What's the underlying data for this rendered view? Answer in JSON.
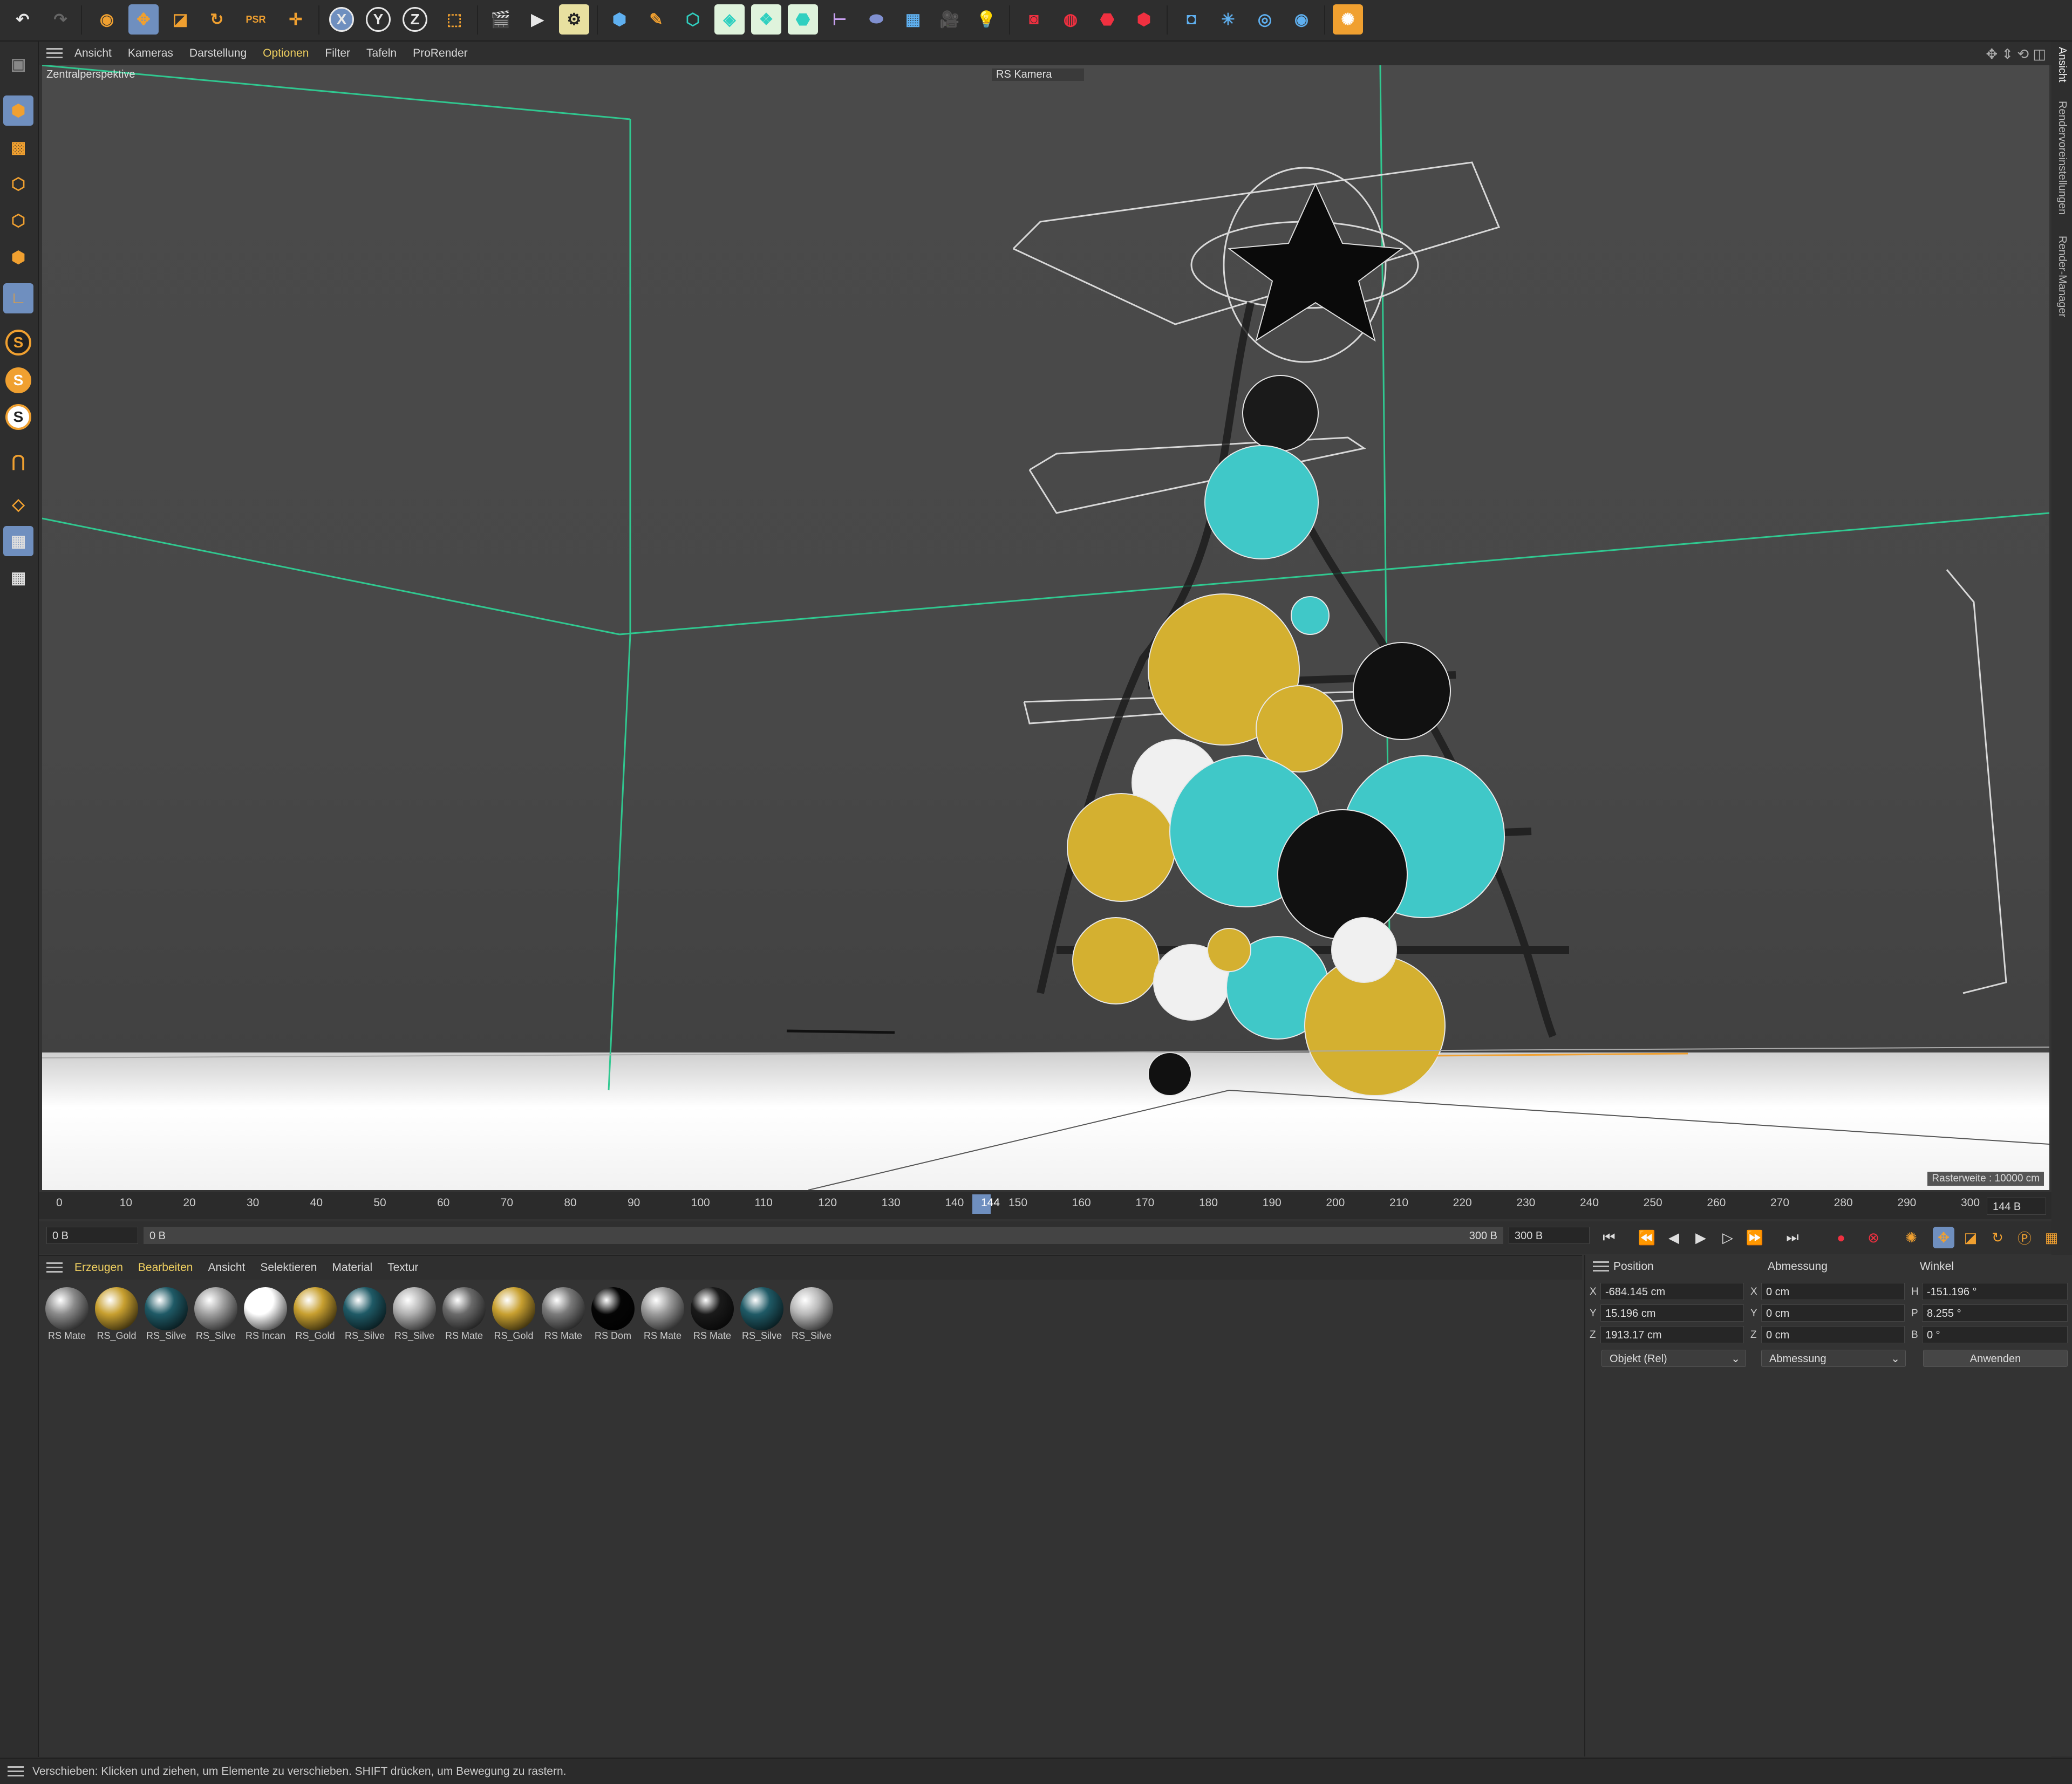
{
  "viewport": {
    "menu": [
      "Ansicht",
      "Kameras",
      "Darstellung",
      "Optionen",
      "Filter",
      "Tafeln",
      "ProRender"
    ],
    "active_menu": "Optionen",
    "perspective_label": "Zentralperspektive",
    "camera_label": "RS Kamera",
    "raster_label": "Rasterweite : 10000 cm"
  },
  "right_tabs": [
    "Ansicht",
    "Rendervoreinstellungen",
    "Render-Manager"
  ],
  "timeline": {
    "ticks": [
      "0",
      "10",
      "20",
      "30",
      "40",
      "50",
      "60",
      "70",
      "80",
      "90",
      "100",
      "110",
      "120",
      "130",
      "140",
      "150",
      "160",
      "170",
      "180",
      "190",
      "200",
      "210",
      "220",
      "230",
      "240",
      "250",
      "260",
      "270",
      "280",
      "290",
      "300"
    ],
    "current_frame": "144",
    "current_frame_field": "144 B",
    "start_field": "0 B",
    "range_start": "0 B",
    "range_end": "300 B",
    "end_field": "300 B"
  },
  "materials": {
    "menu": [
      "Erzeugen",
      "Bearbeiten",
      "Ansicht",
      "Selektieren",
      "Material",
      "Textur"
    ],
    "items": [
      {
        "label": "RS Mate",
        "color": "#8a8a8a"
      },
      {
        "label": "RS_Gold",
        "color": "#c8a030"
      },
      {
        "label": "RS_Silve",
        "color": "#1f5a66"
      },
      {
        "label": "RS_Silve",
        "color": "#a0a0a0"
      },
      {
        "label": "RS Incan",
        "color": "#ffffff"
      },
      {
        "label": "RS_Gold",
        "color": "#c8a030"
      },
      {
        "label": "RS_Silve",
        "color": "#1f5a66"
      },
      {
        "label": "RS_Silve",
        "color": "#b0b0b0"
      },
      {
        "label": "RS Mate",
        "color": "#6a6a6a"
      },
      {
        "label": "RS_Gold",
        "color": "#c8a030"
      },
      {
        "label": "RS Mate",
        "color": "#7a7a7a"
      },
      {
        "label": "RS Dom",
        "color": "#050505"
      },
      {
        "label": "RS Mate",
        "color": "#9a9a9a"
      },
      {
        "label": "RS Mate",
        "color": "#1a1a1a"
      },
      {
        "label": "RS_Silve",
        "color": "#1f5a66"
      },
      {
        "label": "RS_Silve",
        "color": "#b8b8b8"
      }
    ]
  },
  "attributes": {
    "headers": {
      "position": "Position",
      "abmessung": "Abmessung",
      "winkel": "Winkel"
    },
    "position": {
      "x_label": "X",
      "x": "-684.145 cm",
      "y_label": "Y",
      "y": "15.196 cm",
      "z_label": "Z",
      "z": "1913.17 cm"
    },
    "abmessung": {
      "x_label": "X",
      "x": "0 cm",
      "y_label": "Y",
      "y": "0 cm",
      "z_label": "Z",
      "z": "0 cm"
    },
    "winkel": {
      "h_label": "H",
      "h": "-151.196 °",
      "p_label": "P",
      "p": "8.255 °",
      "b_label": "B",
      "b": "0 °"
    },
    "mode_dropdown": "Objekt (Rel)",
    "size_dropdown": "Abmessung",
    "apply_button": "Anwenden"
  },
  "status_bar": "Verschieben: Klicken und ziehen, um Elemente zu verschieben. SHIFT drücken, um Bewegung zu rastern.",
  "colors": {
    "accent": "#6f8fbf",
    "menu_active": "#f0d060",
    "gold": "#d4b030",
    "teal": "#40c8c8",
    "guide_green": "#30c890"
  }
}
